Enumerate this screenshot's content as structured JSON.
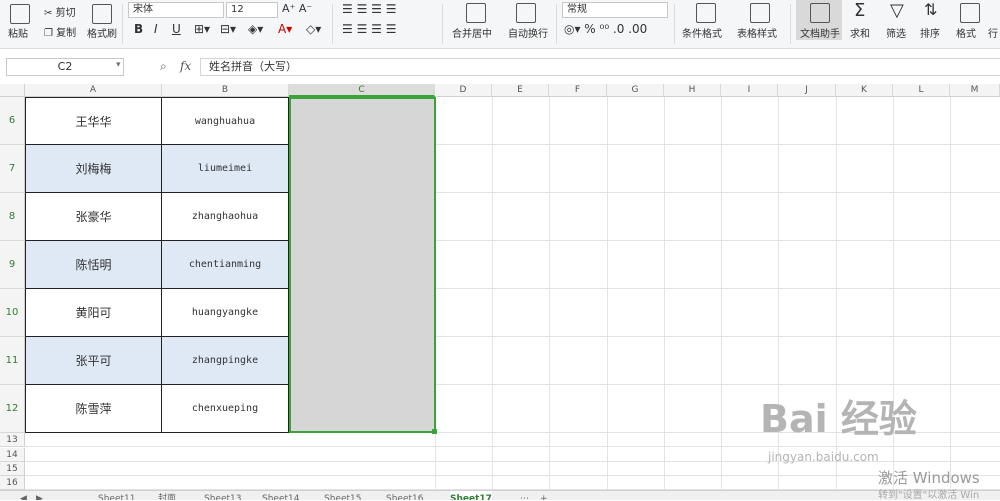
{
  "ribbon": {
    "paste": "粘贴",
    "cut": "剪切",
    "copy": "复制",
    "format_painter": "格式刷",
    "font_name": "宋体",
    "font_size": "12",
    "bold": "B",
    "italic": "I",
    "underline": "U",
    "number_format": "常规",
    "merge_center": "合并居中",
    "wrap_text": "自动换行",
    "conditional_format": "条件格式",
    "table_style": "表格样式",
    "doc_assistant": "文档助手",
    "sum": "求和",
    "filter": "筛选",
    "sort": "排序",
    "format": "格式",
    "row": "行"
  },
  "formula_bar": {
    "name_box": "C2",
    "fx": "fx",
    "content": "姓名拼音（大写）"
  },
  "columns": [
    "A",
    "B",
    "C",
    "D",
    "E",
    "F",
    "G",
    "H",
    "I",
    "J",
    "K",
    "L",
    "M"
  ],
  "rows": [
    {
      "num": "6",
      "a": "王华华",
      "b": "wanghuahua"
    },
    {
      "num": "7",
      "a": "刘梅梅",
      "b": "liumeimei"
    },
    {
      "num": "8",
      "a": "张豪华",
      "b": "zhanghaohua"
    },
    {
      "num": "9",
      "a": "陈恬明",
      "b": "chentianming"
    },
    {
      "num": "10",
      "a": "黄阳可",
      "b": "huangyangke"
    },
    {
      "num": "11",
      "a": "张平可",
      "b": "zhangpingke"
    },
    {
      "num": "12",
      "a": "陈雪萍",
      "b": "chenxueping"
    }
  ],
  "small_rows": [
    "13",
    "14",
    "15",
    "16"
  ],
  "sheet_tabs": [
    "Sheet11",
    "封面",
    "Sheet13",
    "Sheet14",
    "Sheet15",
    "Sheet16",
    "Sheet17"
  ],
  "active_sheet": "Sheet17",
  "colors": {
    "selection_border": "#3aa33a",
    "selection_fill": "#d6d6d6",
    "band_fill": "#dfe9f5"
  },
  "watermark": {
    "brand": "Bai 经验",
    "url": "jingyan.baidu.com",
    "activate": "激活 Windows",
    "activate_sub": "转到\"设置\"以激活 Win"
  }
}
